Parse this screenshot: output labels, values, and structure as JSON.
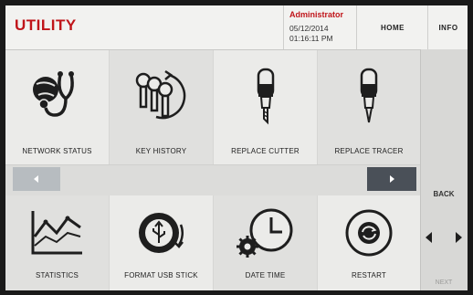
{
  "header": {
    "title": "UTILITY",
    "user": "Administrator",
    "date": "05/12/2014",
    "time": "01:16:11 PM",
    "home_label": "HOME",
    "info_label": "INFO"
  },
  "tiles_row1": [
    {
      "label": "NETWORK STATUS",
      "icon": "network-status-icon"
    },
    {
      "label": "KEY HISTORY",
      "icon": "key-history-icon"
    },
    {
      "label": "REPLACE CUTTER",
      "icon": "cutter-icon"
    },
    {
      "label": "REPLACE TRACER",
      "icon": "tracer-icon"
    }
  ],
  "tiles_row2": [
    {
      "label": "STATISTICS",
      "icon": "statistics-icon"
    },
    {
      "label": "FORMAT USB STICK",
      "icon": "usb-icon"
    },
    {
      "label": "DATE TIME",
      "icon": "clock-icon"
    },
    {
      "label": "RESTART",
      "icon": "restart-icon"
    }
  ],
  "side": {
    "back_label": "BACK",
    "next_label": "NEXT"
  },
  "colors": {
    "brand_red": "#c0151a",
    "nav_dark": "#4a5058",
    "nav_light": "#b7bcc0"
  }
}
